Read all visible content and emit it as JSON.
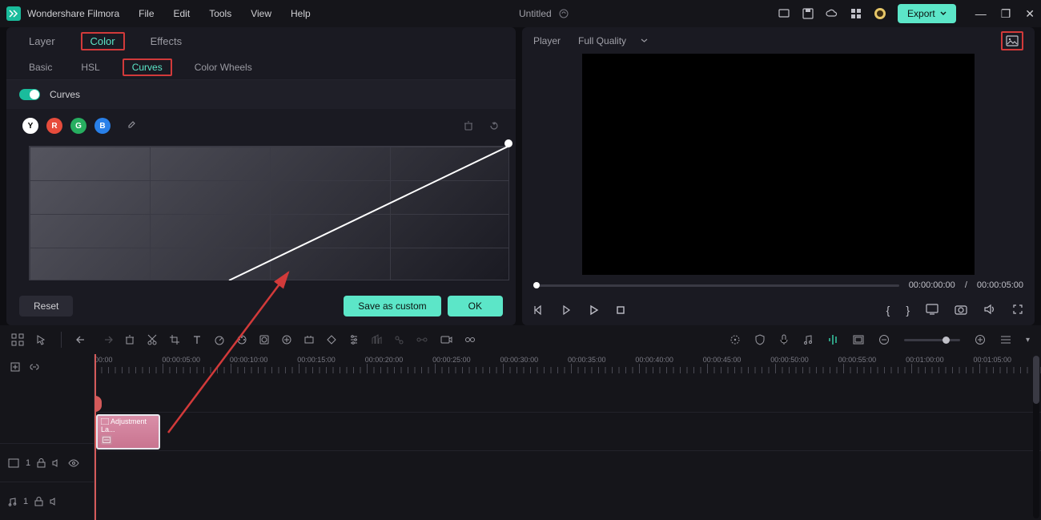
{
  "app": {
    "name": "Wondershare Filmora"
  },
  "menu": {
    "file": "File",
    "edit": "Edit",
    "tools": "Tools",
    "view": "View",
    "help": "Help"
  },
  "title": "Untitled",
  "export_label": "Export",
  "left": {
    "tabs": {
      "layer": "Layer",
      "color": "Color",
      "effects": "Effects"
    },
    "subtabs": {
      "basic": "Basic",
      "hsl": "HSL",
      "curves": "Curves",
      "wheels": "Color Wheels"
    },
    "toggle_label": "Curves",
    "channels": {
      "y": "Y",
      "r": "R",
      "g": "G",
      "b": "B"
    },
    "buttons": {
      "reset": "Reset",
      "save_custom": "Save as custom",
      "ok": "OK"
    }
  },
  "player": {
    "label": "Player",
    "quality": "Full Quality",
    "time_current": "00:00:00:00",
    "time_sep": "/",
    "time_total": "00:00:05:00"
  },
  "ruler": [
    "00:00",
    "00:00:05:00",
    "00:00:10:00",
    "00:00:15:00",
    "00:00:20:00",
    "00:00:25:00",
    "00:00:30:00",
    "00:00:35:00",
    "00:00:40:00",
    "00:00:45:00",
    "00:00:50:00",
    "00:00:55:00",
    "00:01:00:00",
    "00:01:05:00"
  ],
  "clip": {
    "label": "Adjustment La..."
  },
  "track": {
    "video_idx": "1",
    "audio_idx": "1"
  }
}
